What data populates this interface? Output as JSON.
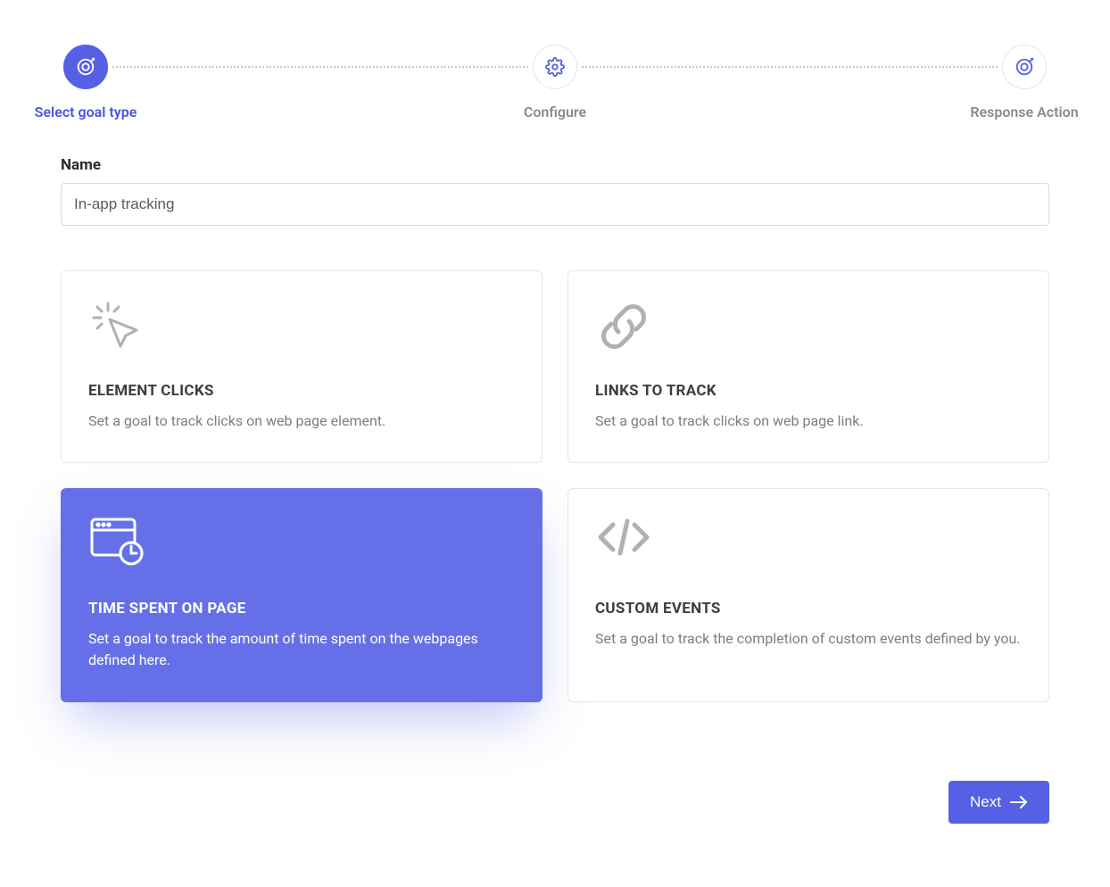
{
  "stepper": {
    "steps": [
      {
        "label": "Select goal type",
        "active": true
      },
      {
        "label": "Configure",
        "active": false
      },
      {
        "label": "Response Action",
        "active": false
      }
    ]
  },
  "nameField": {
    "label": "Name",
    "value": "In-app tracking"
  },
  "cards": [
    {
      "id": "element-clicks",
      "title": "ELEMENT CLICKS",
      "desc": "Set a goal to track clicks on web page element.",
      "selected": false,
      "icon": "cursor-click-icon"
    },
    {
      "id": "links-to-track",
      "title": "LINKS TO TRACK",
      "desc": "Set a goal to track clicks on web page link.",
      "selected": false,
      "icon": "link-icon"
    },
    {
      "id": "time-spent",
      "title": "TIME SPENT ON PAGE",
      "desc": "Set a goal to track the amount of time spent on the webpages defined here.",
      "selected": true,
      "icon": "browser-clock-icon"
    },
    {
      "id": "custom-events",
      "title": "CUSTOM EVENTS",
      "desc": "Set a goal to track the completion of custom events defined by you.",
      "selected": false,
      "icon": "code-icon"
    }
  ],
  "footer": {
    "nextLabel": "Next"
  },
  "colors": {
    "accent": "#5660e4",
    "muted": "#8a8a8f"
  }
}
